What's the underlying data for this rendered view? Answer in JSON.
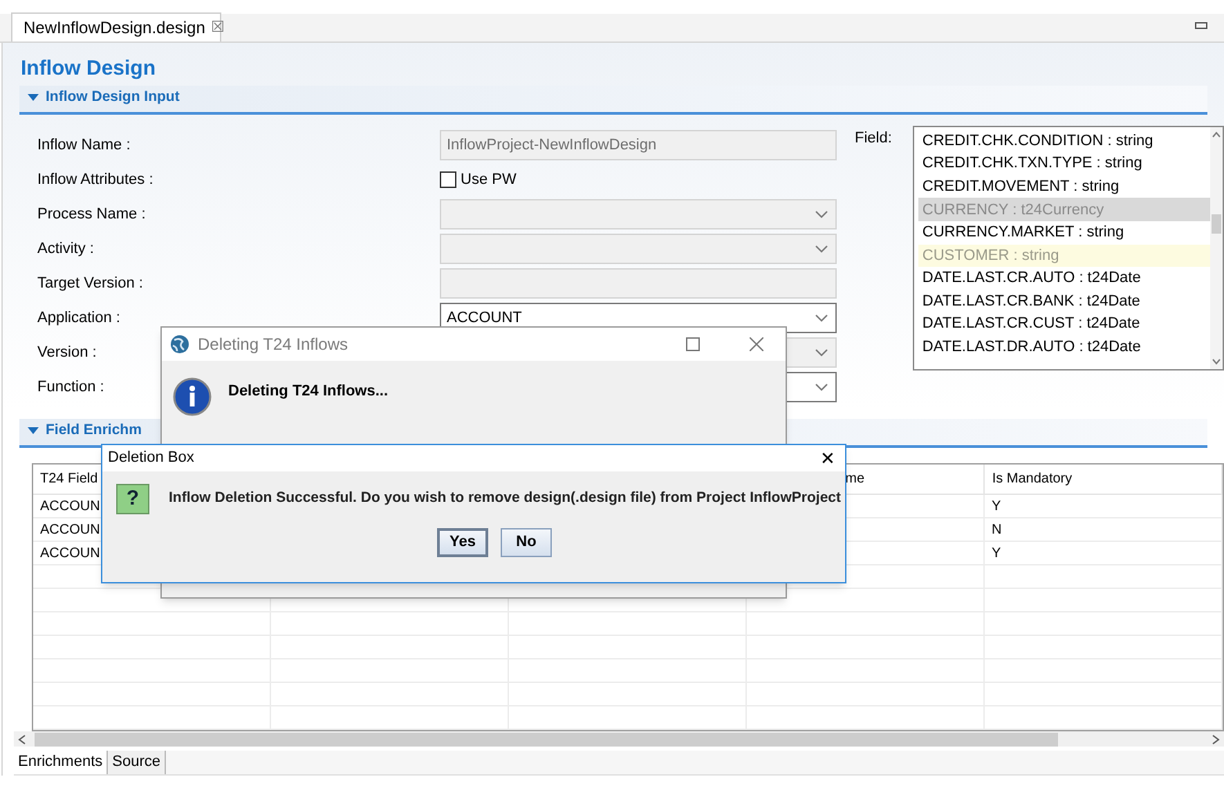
{
  "editor_tab": {
    "title": "NewInflowDesign.design",
    "close": "☒"
  },
  "page_title": "Inflow Design",
  "input_section": {
    "title": "Inflow Design Input",
    "expanded": true,
    "rows": [
      {
        "label": "Inflow Name :",
        "kind": "text",
        "value": "InflowProject-NewInflowDesign",
        "disabled": true
      },
      {
        "label": "Inflow Attributes :",
        "kind": "checkbox",
        "value": "Use PW",
        "checked": false
      },
      {
        "label": "Process Name :",
        "kind": "combo",
        "disabled": true
      },
      {
        "label": "Activity :",
        "kind": "combo",
        "disabled": true
      },
      {
        "label": "Target Version :",
        "kind": "text",
        "disabled": true
      },
      {
        "label": "Application :",
        "kind": "combo",
        "value": "ACCOUNT",
        "disabled": false
      },
      {
        "label": "Version :",
        "kind": "combo",
        "disabled": true
      },
      {
        "label": "Function :",
        "kind": "combo",
        "disabled": false
      }
    ],
    "field_label": "Field:",
    "fields": [
      {
        "text": "CREDIT.CHK.CONDITION : string",
        "selected": false,
        "highlighted": false
      },
      {
        "text": "CREDIT.CHK.TXN.TYPE : string",
        "selected": false,
        "highlighted": false
      },
      {
        "text": "CREDIT.MOVEMENT : string",
        "selected": false,
        "highlighted": false
      },
      {
        "text": "CURRENCY : t24Currency",
        "selected": true,
        "highlighted": false
      },
      {
        "text": "CURRENCY.MARKET : string",
        "selected": false,
        "highlighted": false
      },
      {
        "text": "CUSTOMER : string",
        "selected": false,
        "highlighted": true
      },
      {
        "text": "DATE.LAST.CR.AUTO : t24Date",
        "selected": false,
        "highlighted": false
      },
      {
        "text": "DATE.LAST.CR.BANK : t24Date",
        "selected": false,
        "highlighted": false
      },
      {
        "text": "DATE.LAST.CR.CUST : t24Date",
        "selected": false,
        "highlighted": false
      },
      {
        "text": "DATE.LAST.DR.AUTO : t24Date",
        "selected": false,
        "highlighted": false
      }
    ]
  },
  "enrichment_section": {
    "title": "Field Enrichm",
    "expanded": true,
    "table": {
      "columns": [
        "T24 Field",
        "",
        "",
        "me",
        "Is Mandatory"
      ],
      "rows": [
        [
          "ACCOUN",
          "Y"
        ],
        [
          "ACCOUN",
          "N"
        ],
        [
          "ACCOUN",
          "Y"
        ]
      ]
    }
  },
  "bottom_tabs": [
    {
      "label": "Enrichments",
      "selected": true
    },
    {
      "label": "Source",
      "selected": false
    }
  ],
  "progress_dialog": {
    "title": "Deleting T24 Inflows",
    "message": "Deleting T24 Inflows..."
  },
  "deletion_dialog": {
    "title": "Deletion Box",
    "close": "✕",
    "icon": "?",
    "message": "Inflow Deletion Successful. Do you wish to remove design(.design file) from Project InflowProject",
    "buttons": [
      {
        "label": "Yes",
        "focused": true
      },
      {
        "label": "No",
        "focused": false
      }
    ]
  }
}
